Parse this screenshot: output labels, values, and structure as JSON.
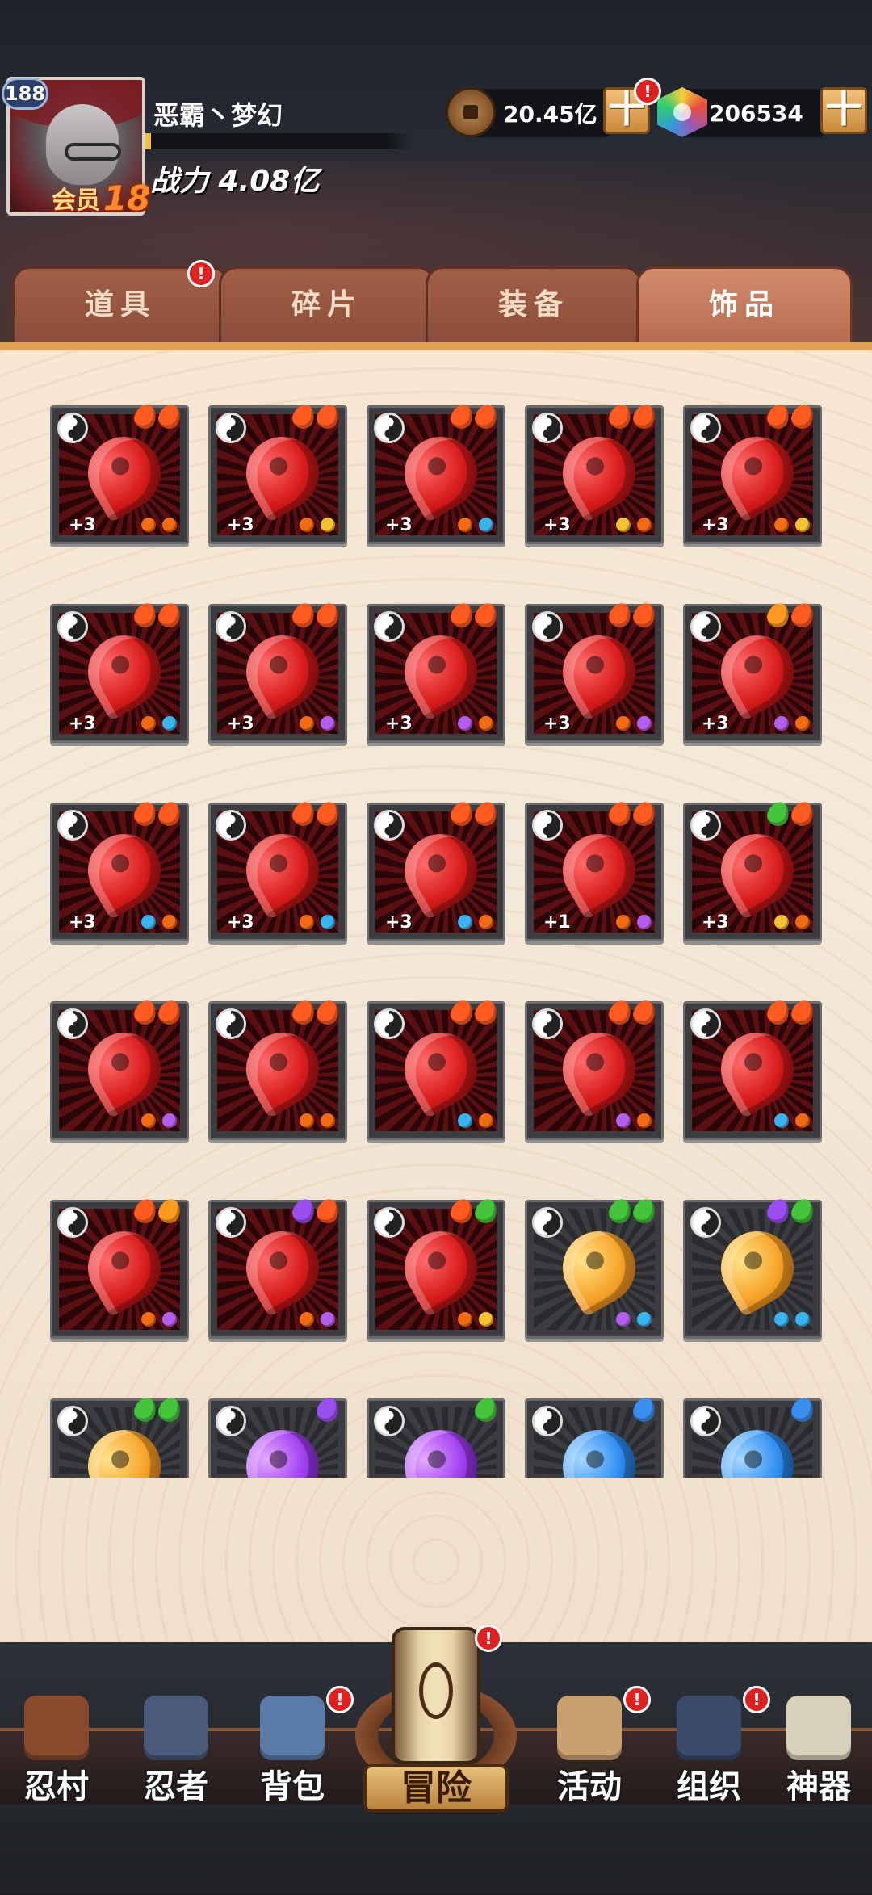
{
  "player": {
    "level": "188",
    "name": "恶霸丶梦幻",
    "vip_label": "会员",
    "vip_level": "18",
    "power_label": "战力 4.08亿",
    "exp_progress": 0.02
  },
  "currency": {
    "coins": "20.45亿",
    "gems": "206534",
    "plus_label": "十",
    "alert": "!"
  },
  "tabs": [
    {
      "label": "道具",
      "active": false,
      "alert": true
    },
    {
      "label": "碎片",
      "active": false,
      "alert": false
    },
    {
      "label": "装备",
      "active": false,
      "alert": false
    },
    {
      "label": "饰品",
      "active": true,
      "alert": false
    }
  ],
  "colors": {
    "fire_red": "#ff5a1f",
    "fire_orange": "#ff9a1f",
    "fire_purple": "#9b4ef0",
    "fire_green": "#43c43a",
    "fire_blue": "#3a8ef0",
    "gem_orange": "#f26a12",
    "gem_yellow": "#f4c230",
    "gem_blue": "#3ab4f0",
    "gem_purple": "#b45ef0"
  },
  "items": [
    {
      "color": "red",
      "level": "+3",
      "flames": [
        "fire_red",
        "fire_red"
      ],
      "gems": [
        "gem_orange",
        "gem_orange"
      ]
    },
    {
      "color": "red",
      "level": "+3",
      "flames": [
        "fire_red",
        "fire_red"
      ],
      "gems": [
        "gem_orange",
        "gem_yellow"
      ]
    },
    {
      "color": "red",
      "level": "+3",
      "flames": [
        "fire_red",
        "fire_red"
      ],
      "gems": [
        "gem_orange",
        "gem_blue"
      ]
    },
    {
      "color": "red",
      "level": "+3",
      "flames": [
        "fire_red",
        "fire_red"
      ],
      "gems": [
        "gem_yellow",
        "gem_orange"
      ]
    },
    {
      "color": "red",
      "level": "+3",
      "flames": [
        "fire_red",
        "fire_red"
      ],
      "gems": [
        "gem_orange",
        "gem_yellow"
      ]
    },
    {
      "color": "red",
      "level": "+3",
      "flames": [
        "fire_red",
        "fire_red"
      ],
      "gems": [
        "gem_orange",
        "gem_blue"
      ]
    },
    {
      "color": "red",
      "level": "+3",
      "flames": [
        "fire_red",
        "fire_red"
      ],
      "gems": [
        "gem_orange",
        "gem_purple"
      ]
    },
    {
      "color": "red",
      "level": "+3",
      "flames": [
        "fire_red",
        "fire_red"
      ],
      "gems": [
        "gem_purple",
        "gem_orange"
      ]
    },
    {
      "color": "red",
      "level": "+3",
      "flames": [
        "fire_red",
        "fire_red"
      ],
      "gems": [
        "gem_orange",
        "gem_purple"
      ]
    },
    {
      "color": "red",
      "level": "+3",
      "flames": [
        "fire_orange",
        "fire_red"
      ],
      "gems": [
        "gem_purple",
        "gem_orange"
      ]
    },
    {
      "color": "red",
      "level": "+3",
      "flames": [
        "fire_red",
        "fire_red"
      ],
      "gems": [
        "gem_blue",
        "gem_orange"
      ]
    },
    {
      "color": "red",
      "level": "+3",
      "flames": [
        "fire_red",
        "fire_red"
      ],
      "gems": [
        "gem_orange",
        "gem_blue"
      ]
    },
    {
      "color": "red",
      "level": "+3",
      "flames": [
        "fire_red",
        "fire_red"
      ],
      "gems": [
        "gem_blue",
        "gem_orange"
      ]
    },
    {
      "color": "red",
      "level": "+1",
      "flames": [
        "fire_red",
        "fire_red"
      ],
      "gems": [
        "gem_orange",
        "gem_purple"
      ]
    },
    {
      "color": "red",
      "level": "+3",
      "flames": [
        "fire_green",
        "fire_red"
      ],
      "gems": [
        "gem_yellow",
        "gem_orange"
      ]
    },
    {
      "color": "red",
      "level": "",
      "flames": [
        "fire_red",
        "fire_red"
      ],
      "gems": [
        "gem_orange",
        "gem_purple"
      ]
    },
    {
      "color": "red",
      "level": "",
      "flames": [
        "fire_red",
        "fire_red"
      ],
      "gems": [
        "gem_orange",
        "gem_orange"
      ]
    },
    {
      "color": "red",
      "level": "",
      "flames": [
        "fire_red",
        "fire_red"
      ],
      "gems": [
        "gem_blue",
        "gem_orange"
      ]
    },
    {
      "color": "red",
      "level": "",
      "flames": [
        "fire_red",
        "fire_red"
      ],
      "gems": [
        "gem_purple",
        "gem_orange"
      ]
    },
    {
      "color": "red",
      "level": "",
      "flames": [
        "fire_red",
        "fire_red"
      ],
      "gems": [
        "gem_blue",
        "gem_orange"
      ]
    },
    {
      "color": "red",
      "level": "",
      "flames": [
        "fire_red",
        "fire_orange"
      ],
      "gems": [
        "gem_orange",
        "gem_purple"
      ]
    },
    {
      "color": "red",
      "level": "",
      "flames": [
        "fire_purple",
        "fire_red"
      ],
      "gems": [
        "gem_orange",
        "gem_purple"
      ]
    },
    {
      "color": "red",
      "level": "",
      "flames": [
        "fire_red",
        "fire_green"
      ],
      "gems": [
        "gem_orange",
        "gem_yellow"
      ]
    },
    {
      "color": "orange",
      "level": "",
      "flames": [
        "fire_green",
        "fire_green"
      ],
      "gems": [
        "gem_purple",
        "gem_blue"
      ]
    },
    {
      "color": "orange",
      "level": "",
      "flames": [
        "fire_purple",
        "fire_green"
      ],
      "gems": [
        "gem_blue",
        "gem_blue"
      ]
    },
    {
      "color": "orange",
      "level": "",
      "flames": [
        "fire_green",
        "fire_green"
      ],
      "gems": []
    },
    {
      "color": "purple",
      "level": "",
      "flames": [
        "fire_purple"
      ],
      "gems": []
    },
    {
      "color": "purple",
      "level": "",
      "flames": [
        "fire_green"
      ],
      "gems": []
    },
    {
      "color": "blue",
      "level": "",
      "flames": [
        "fire_blue"
      ],
      "gems": []
    },
    {
      "color": "blue",
      "level": "",
      "flames": [
        "fire_blue"
      ],
      "gems": []
    }
  ],
  "nav": [
    {
      "label": "忍村",
      "icon": "village-gate-icon",
      "color": "#8a4a2e",
      "alert": false
    },
    {
      "label": "忍者",
      "icon": "ninja-head-icon",
      "color": "#4a5a7a",
      "alert": false
    },
    {
      "label": "背包",
      "icon": "backpack-icon",
      "color": "#5a7aa8",
      "alert": true
    },
    {
      "label": "冒险",
      "icon": "adventure-scroll-icon",
      "color": "#c8a060",
      "alert": true
    },
    {
      "label": "活动",
      "icon": "drum-icon",
      "color": "#c9a070",
      "alert": true
    },
    {
      "label": "组织",
      "icon": "organization-icon",
      "color": "#3a4a6a",
      "alert": true
    },
    {
      "label": "神器",
      "icon": "artifact-scroll-icon",
      "color": "#d8d0b8",
      "alert": false
    }
  ]
}
